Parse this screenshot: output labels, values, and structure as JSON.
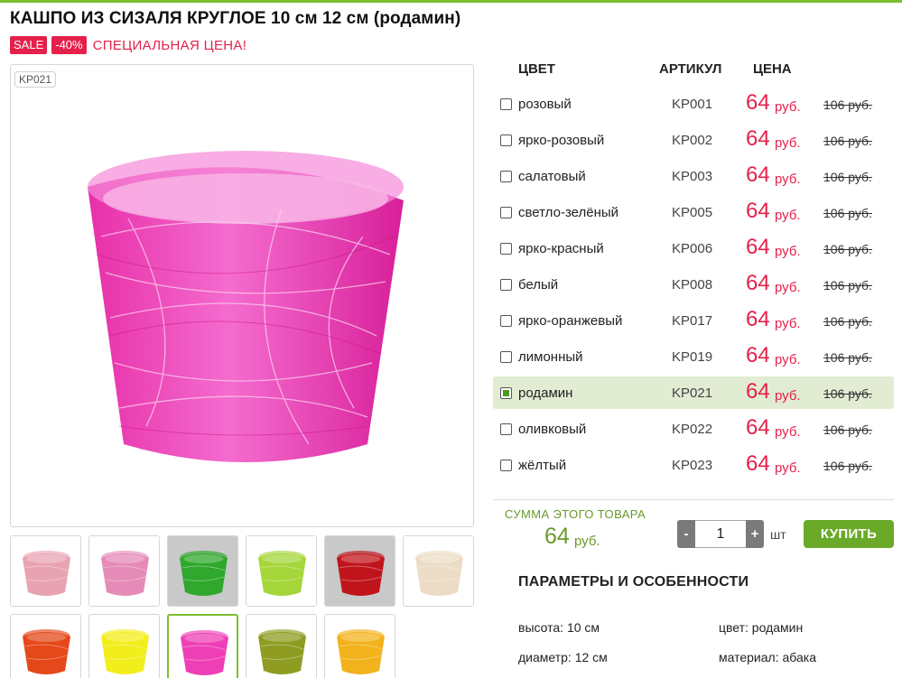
{
  "product": {
    "title": "КАШПО ИЗ СИЗАЛЯ КРУГЛОЕ 10 см 12 см (родамин)",
    "sale_badge": "SALE",
    "discount_badge": "-40%",
    "promo_text": "СПЕЦИАЛЬНАЯ ЦЕНА!",
    "image_code": "KP021"
  },
  "table": {
    "headers": {
      "color": "ЦВЕТ",
      "article": "АРТИКУЛ",
      "price": "ЦЕНА"
    },
    "rows": [
      {
        "name": "розовый",
        "article": "KP001",
        "price": "64",
        "currency": "руб.",
        "old_price": "106 руб.",
        "checked": false
      },
      {
        "name": "ярко-розовый",
        "article": "KP002",
        "price": "64",
        "currency": "руб.",
        "old_price": "106 руб.",
        "checked": false
      },
      {
        "name": "салатовый",
        "article": "KP003",
        "price": "64",
        "currency": "руб.",
        "old_price": "106 руб.",
        "checked": false
      },
      {
        "name": "светло-зелёный",
        "article": "KP005",
        "price": "64",
        "currency": "руб.",
        "old_price": "106 руб.",
        "checked": false
      },
      {
        "name": "ярко-красный",
        "article": "KP006",
        "price": "64",
        "currency": "руб.",
        "old_price": "106 руб.",
        "checked": false
      },
      {
        "name": "белый",
        "article": "KP008",
        "price": "64",
        "currency": "руб.",
        "old_price": "106 руб.",
        "checked": false
      },
      {
        "name": "ярко-оранжевый",
        "article": "KP017",
        "price": "64",
        "currency": "руб.",
        "old_price": "106 руб.",
        "checked": false
      },
      {
        "name": "лимонный",
        "article": "KP019",
        "price": "64",
        "currency": "руб.",
        "old_price": "106 руб.",
        "checked": false
      },
      {
        "name": "родамин",
        "article": "KP021",
        "price": "64",
        "currency": "руб.",
        "old_price": "106 руб.",
        "checked": true
      },
      {
        "name": "оливковый",
        "article": "KP022",
        "price": "64",
        "currency": "руб.",
        "old_price": "106 руб.",
        "checked": false
      },
      {
        "name": "жёлтый",
        "article": "KP023",
        "price": "64",
        "currency": "руб.",
        "old_price": "106 руб.",
        "checked": false
      }
    ]
  },
  "summary": {
    "label": "СУММА ЭТОГО ТОВАРА",
    "value": "64",
    "currency": "руб."
  },
  "quantity": {
    "minus": "-",
    "value": "1",
    "plus": "+",
    "unit": "шт"
  },
  "buy_label": "КУПИТЬ",
  "params": {
    "title": "ПАРАМЕТРЫ И ОСОБЕННОСТИ",
    "height": "высота: 10 см",
    "diameter": "диаметр: 12 см",
    "color": "цвет: родамин",
    "material": "материал: абака"
  },
  "thumbnails": [
    {
      "color": "#e8a3b3",
      "name": "thumb-rose"
    },
    {
      "color": "#e58bb8",
      "name": "thumb-bright-pink"
    },
    {
      "color": "#2fa82d",
      "name": "thumb-green"
    },
    {
      "color": "#a5d63a",
      "name": "thumb-light-green"
    },
    {
      "color": "#c0141c",
      "name": "thumb-red"
    },
    {
      "color": "#ecdcc5",
      "name": "thumb-white"
    },
    {
      "color": "#e5481a",
      "name": "thumb-orange"
    },
    {
      "color": "#f2ee1c",
      "name": "thumb-lemon"
    },
    {
      "color": "#ee3fb6",
      "name": "thumb-rhodamine"
    },
    {
      "color": "#8e9c22",
      "name": "thumb-olive"
    },
    {
      "color": "#f2b21c",
      "name": "thumb-yellow"
    }
  ],
  "accent_colors": {
    "green": "#7bbf2e",
    "price_red": "#e5204b",
    "selected_row": "#e1ecd3"
  }
}
